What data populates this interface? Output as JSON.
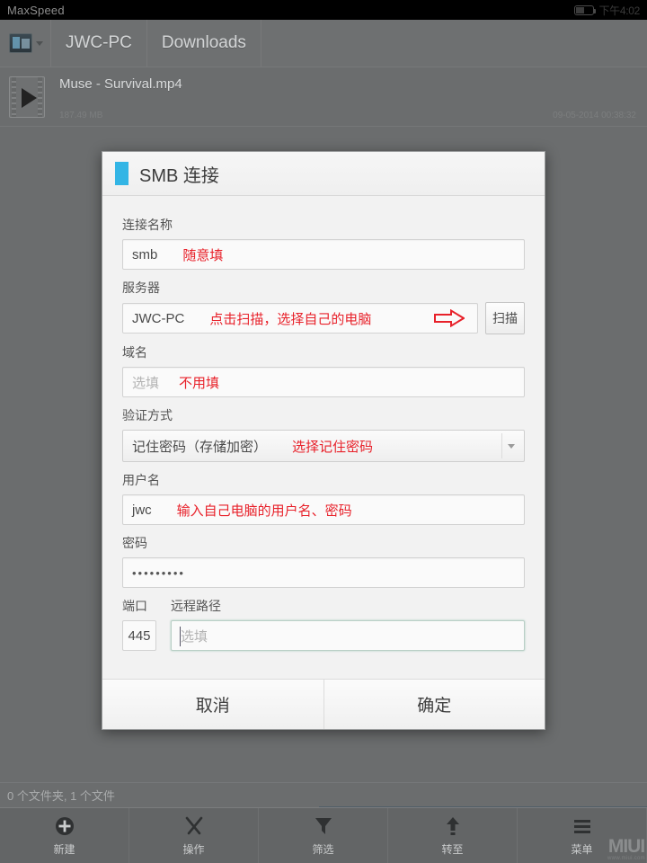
{
  "status_bar": {
    "app_name": "MaxSpeed",
    "battery_icon": "battery-icon",
    "time": "下午4:02"
  },
  "breadcrumb": {
    "device_icon": "device-icon",
    "dropdown_icon": "chevron-down-icon",
    "items": [
      {
        "label": "JWC-PC"
      },
      {
        "label": "Downloads"
      }
    ]
  },
  "file_list": {
    "rows": [
      {
        "icon": "video-file-icon",
        "name": "Muse - Survival.mp4",
        "size": "187.49 MB",
        "date": "09-05-2014 00:38:32"
      }
    ],
    "count_text": "0 个文件夹, 1 个文件"
  },
  "dialog": {
    "accent_color": "#33b5e5",
    "title": "SMB 连接",
    "fields": {
      "connection_name": {
        "label": "连接名称",
        "value": "smb",
        "hint": "随意填"
      },
      "server": {
        "label": "服务器",
        "value": "JWC-PC",
        "hint": "点击扫描，选择自己的电脑",
        "arrow_icon": "arrow-right-icon",
        "scan_button": "扫描"
      },
      "domain": {
        "label": "域名",
        "placeholder": "选填",
        "hint": "不用填"
      },
      "auth_method": {
        "label": "验证方式",
        "value": "记住密码（存储加密）",
        "hint": "选择记住密码",
        "caret_icon": "chevron-down-icon"
      },
      "username": {
        "label": "用户名",
        "value": "jwc",
        "hint": "输入自己电脑的用户名、密码"
      },
      "password": {
        "label": "密码",
        "value": "•••••••••"
      },
      "port": {
        "label": "端口",
        "value": "445"
      },
      "remote_path": {
        "label": "远程路径",
        "placeholder": "选填"
      }
    },
    "buttons": {
      "cancel": "取消",
      "confirm": "确定"
    }
  },
  "toolbar": {
    "items": [
      {
        "icon": "plus-circle-icon",
        "label": "新建"
      },
      {
        "icon": "tools-icon",
        "label": "操作"
      },
      {
        "icon": "funnel-icon",
        "label": "筛选"
      },
      {
        "icon": "goto-arrow-icon",
        "label": "转至"
      },
      {
        "icon": "hamburger-icon",
        "label": "菜单"
      }
    ]
  },
  "watermark": {
    "title": "MIUI",
    "url": "www.miui.com"
  }
}
